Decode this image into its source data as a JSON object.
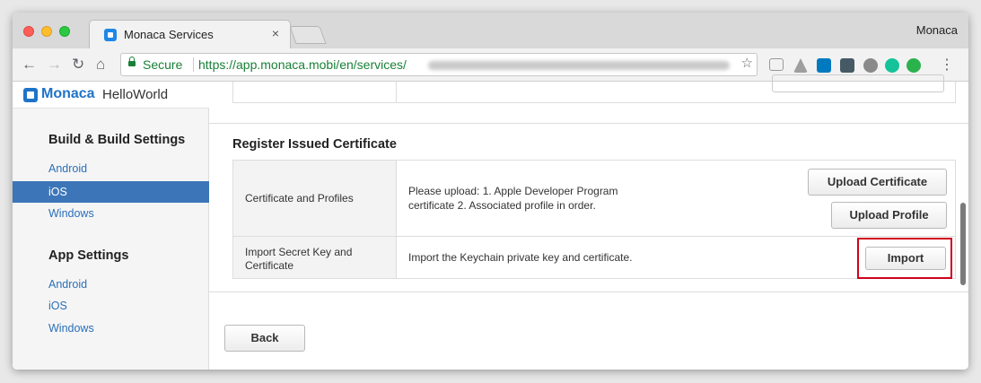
{
  "browser": {
    "tab_title": "Monaca Services",
    "tab_close": "×",
    "profile_name": "Monaca",
    "secure_label": "Secure",
    "url_visible": "https://app.monaca.mobi/en/services/",
    "nav": {
      "back": "←",
      "forward": "→",
      "reload": "↻",
      "home": "⌂",
      "star": "☆",
      "menu": "⋮"
    }
  },
  "sidebar": {
    "brand": "Monaca",
    "app_name": "HelloWorld",
    "sections": [
      {
        "title": "Build & Build Settings",
        "items": [
          "Android",
          "iOS",
          "Windows"
        ]
      },
      {
        "title": "App Settings",
        "items": [
          "Android",
          "iOS",
          "Windows"
        ]
      }
    ]
  },
  "main": {
    "heading": "Register Issued Certificate",
    "rows": [
      {
        "label": "Certificate and Profiles",
        "description_line1": "Please upload: 1. Apple Developer Program",
        "description_line2": "certificate  2. Associated profile  in order.",
        "buttons": [
          "Upload Certificate",
          "Upload Profile"
        ]
      },
      {
        "label_line1": "Import Secret Key and",
        "label_line2": "Certificate",
        "description": "Import the Keychain private key and certificate.",
        "button": "Import"
      }
    ],
    "back_button": "Back"
  },
  "colors": {
    "accent": "#3d76b8",
    "link": "#2a6fb8",
    "secure_green": "#188038",
    "highlight_red": "#d0021b"
  }
}
